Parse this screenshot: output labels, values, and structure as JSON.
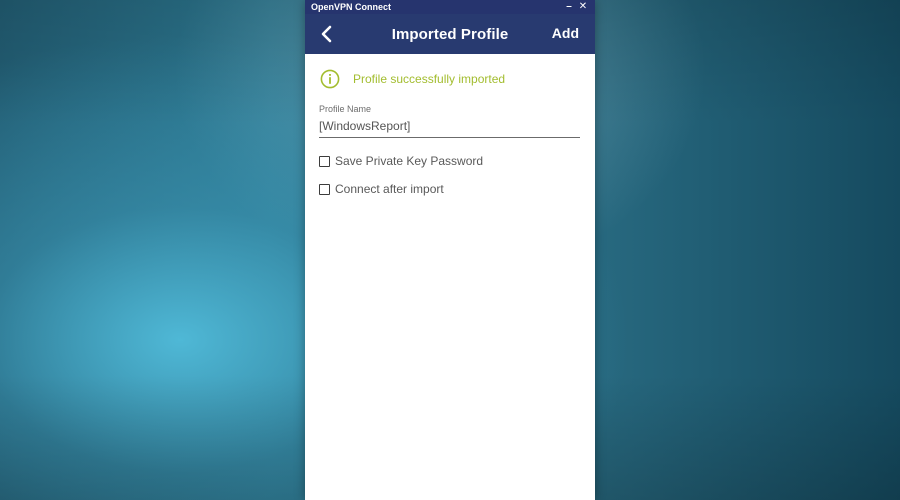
{
  "window": {
    "title": "OpenVPN Connect",
    "minimize_glyph": "–",
    "close_glyph": "✕"
  },
  "header": {
    "back_icon": "chevron-left-icon",
    "title": "Imported Profile",
    "add_label": "Add"
  },
  "notice": {
    "icon": "info-circle-icon",
    "text": "Profile successfully imported"
  },
  "profile_name": {
    "label": "Profile Name",
    "value": "[WindowsReport]"
  },
  "options": {
    "save_password": {
      "label": "Save Private Key Password",
      "checked": false
    },
    "connect_after": {
      "label": "Connect after import",
      "checked": false
    }
  },
  "colors": {
    "header_bg": "#283a70",
    "titlebar_bg": "#26346e",
    "success_text": "#a3bd2f"
  }
}
